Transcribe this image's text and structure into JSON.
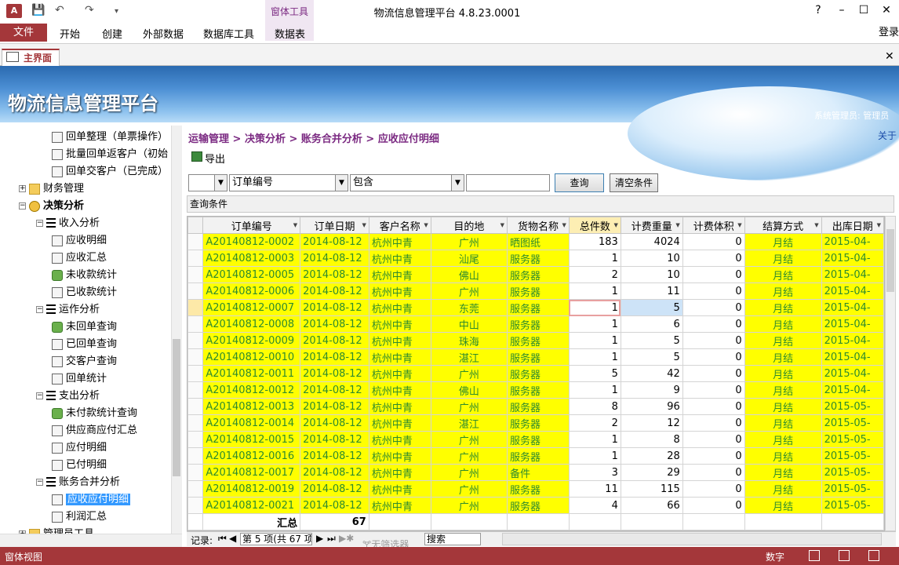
{
  "window": {
    "title": "物流信息管理平台 4.8.23.0001",
    "app_icon": "A",
    "help": "?",
    "minimize": "–",
    "maximize": "☐",
    "close": "✕"
  },
  "ribbon": {
    "file_tab": "文件",
    "tabs": [
      "开始",
      "创建",
      "外部数据",
      "数据库工具",
      "数据表"
    ],
    "contextual_group": "窗体工具",
    "login": "登录"
  },
  "document_tab": {
    "label": "主界面"
  },
  "banner": {
    "title": "物流信息管理平台",
    "user": "系统管理员: 管理员"
  },
  "tree": {
    "items": [
      {
        "label": "回单整理（单票操作）",
        "icon": "doc-icon",
        "indent": 3
      },
      {
        "label": "批量回单返客户（初始",
        "icon": "doc-icon",
        "indent": 3
      },
      {
        "label": "回单交客户（已完成）",
        "icon": "doc-icon",
        "indent": 3
      },
      {
        "label": "财务管理",
        "icon": "folder-icon",
        "indent": 1,
        "expander": "+"
      },
      {
        "label": "决策分析",
        "icon": "lock-icon",
        "indent": 1,
        "expander": "−",
        "bold": true
      },
      {
        "label": "收入分析",
        "icon": "list-icon",
        "indent": 2,
        "expander": "−"
      },
      {
        "label": "应收明细",
        "icon": "doc-icon",
        "indent": 3
      },
      {
        "label": "应收汇总",
        "icon": "doc-icon",
        "indent": 3
      },
      {
        "label": "未收款统计",
        "icon": "money-icon",
        "indent": 3
      },
      {
        "label": "已收款统计",
        "icon": "doc-icon",
        "indent": 3
      },
      {
        "label": "运作分析",
        "icon": "list-icon",
        "indent": 2,
        "expander": "−"
      },
      {
        "label": "未回单查询",
        "icon": "money-icon",
        "indent": 3
      },
      {
        "label": "已回单查询",
        "icon": "doc-icon",
        "indent": 3
      },
      {
        "label": "交客户查询",
        "icon": "doc-icon",
        "indent": 3
      },
      {
        "label": "回单统计",
        "icon": "doc-icon",
        "indent": 3
      },
      {
        "label": "支出分析",
        "icon": "list-icon",
        "indent": 2,
        "expander": "−"
      },
      {
        "label": "未付款统计查询",
        "icon": "money-icon",
        "indent": 3
      },
      {
        "label": "供应商应付汇总",
        "icon": "doc-icon",
        "indent": 3
      },
      {
        "label": "应付明细",
        "icon": "doc-icon",
        "indent": 3
      },
      {
        "label": "已付明细",
        "icon": "doc-icon",
        "indent": 3
      },
      {
        "label": "账务合并分析",
        "icon": "list-icon",
        "indent": 2,
        "expander": "−"
      },
      {
        "label": "应收应付明细",
        "icon": "doc-icon",
        "indent": 3,
        "selected": true
      },
      {
        "label": "利润汇总",
        "icon": "doc-icon",
        "indent": 3
      },
      {
        "label": "管理员工具",
        "icon": "folder-icon",
        "indent": 1,
        "expander": "+"
      }
    ]
  },
  "main": {
    "breadcrumb": "运输管理 > 决策分析 > 账务合并分析 > 应收应付明细",
    "about": "关于",
    "export_label": "导出",
    "filter": {
      "field": "订单编号",
      "operator": "包含",
      "value": "",
      "query_btn": "查询",
      "clear_btn": "清空条件"
    },
    "condition_label": "查询条件"
  },
  "grid": {
    "columns": [
      "订单编号",
      "订单日期",
      "客户名称",
      "目的地",
      "货物名称",
      "总件数",
      "计费重量",
      "计费体积",
      "结算方式",
      "出库日期"
    ],
    "rows": [
      [
        "A20140812-0002",
        "2014-08-12",
        "杭州中青",
        "广州",
        "晒图纸",
        "183",
        "4024",
        "0",
        "月结",
        "2015-04-"
      ],
      [
        "A20140812-0003",
        "2014-08-12",
        "杭州中青",
        "汕尾",
        "服务器",
        "1",
        "10",
        "0",
        "月结",
        "2015-04-"
      ],
      [
        "A20140812-0005",
        "2014-08-12",
        "杭州中青",
        "佛山",
        "服务器",
        "2",
        "10",
        "0",
        "月结",
        "2015-04-"
      ],
      [
        "A20140812-0006",
        "2014-08-12",
        "杭州中青",
        "广州",
        "服务器",
        "1",
        "11",
        "0",
        "月结",
        "2015-04-"
      ],
      [
        "A20140812-0007",
        "2014-08-12",
        "杭州中青",
        "东莞",
        "服务器",
        "1",
        "5",
        "0",
        "月结",
        "2015-04-"
      ],
      [
        "A20140812-0008",
        "2014-08-12",
        "杭州中青",
        "中山",
        "服务器",
        "1",
        "6",
        "0",
        "月结",
        "2015-04-"
      ],
      [
        "A20140812-0009",
        "2014-08-12",
        "杭州中青",
        "珠海",
        "服务器",
        "1",
        "5",
        "0",
        "月结",
        "2015-04-"
      ],
      [
        "A20140812-0010",
        "2014-08-12",
        "杭州中青",
        "湛江",
        "服务器",
        "1",
        "5",
        "0",
        "月结",
        "2015-04-"
      ],
      [
        "A20140812-0011",
        "2014-08-12",
        "杭州中青",
        "广州",
        "服务器",
        "5",
        "42",
        "0",
        "月结",
        "2015-04-"
      ],
      [
        "A20140812-0012",
        "2014-08-12",
        "杭州中青",
        "佛山",
        "服务器",
        "1",
        "9",
        "0",
        "月结",
        "2015-04-"
      ],
      [
        "A20140812-0013",
        "2014-08-12",
        "杭州中青",
        "广州",
        "服务器",
        "8",
        "96",
        "0",
        "月结",
        "2015-05-"
      ],
      [
        "A20140812-0014",
        "2014-08-12",
        "杭州中青",
        "湛江",
        "服务器",
        "2",
        "12",
        "0",
        "月结",
        "2015-05-"
      ],
      [
        "A20140812-0015",
        "2014-08-12",
        "杭州中青",
        "广州",
        "服务器",
        "1",
        "8",
        "0",
        "月结",
        "2015-05-"
      ],
      [
        "A20140812-0016",
        "2014-08-12",
        "杭州中青",
        "广州",
        "服务器",
        "1",
        "28",
        "0",
        "月结",
        "2015-05-"
      ],
      [
        "A20140812-0017",
        "2014-08-12",
        "杭州中青",
        "广州",
        "备件",
        "3",
        "29",
        "0",
        "月结",
        "2015-05-"
      ],
      [
        "A20140812-0019",
        "2014-08-12",
        "杭州中青",
        "广州",
        "服务器",
        "11",
        "115",
        "0",
        "月结",
        "2015-05-"
      ],
      [
        "A20140812-0021",
        "2014-08-12",
        "杭州中青",
        "广州",
        "服务器",
        "4",
        "66",
        "0",
        "月结",
        "2015-05-"
      ]
    ],
    "current_row": 4,
    "summary_label": "汇总",
    "summary_value": "67"
  },
  "record_nav": {
    "label": "记录:",
    "position": "第 5 项(共 67 项",
    "filter": "无筛选器",
    "search": "搜索"
  },
  "status": {
    "left": "窗体视图",
    "numlock": "数字"
  },
  "colors": {
    "accent": "#a4373a",
    "grid_highlight": "#ffff00",
    "breadcrumb": "#7b2a82"
  }
}
